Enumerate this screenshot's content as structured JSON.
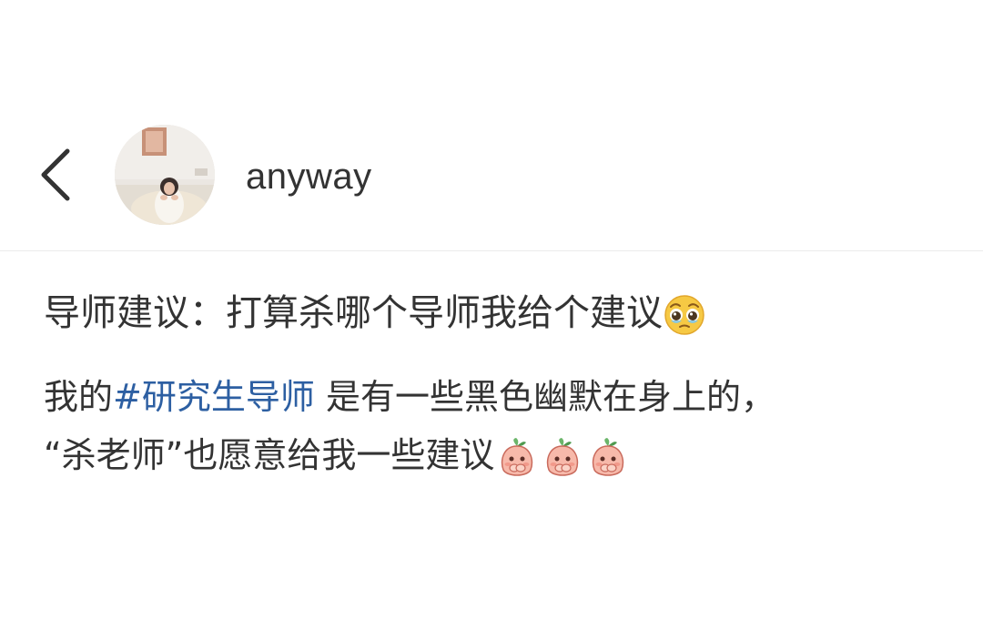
{
  "header": {
    "back_icon": "chevron-left-icon",
    "username": "anyway"
  },
  "post": {
    "title": "导师建议：打算杀哪个导师我给个建议",
    "title_emoji": "pleading-face-icon",
    "body_prefix": "我的",
    "hashtag": "#研究生导师",
    "body_rest": " 是有一些黑色幽默在身上的，",
    "body_line2": "“杀老师”也愿意给我一些建议",
    "trailing_emoji": "peach-face-icon",
    "trailing_emoji_count": 3
  },
  "colors": {
    "text": "#333333",
    "hashtag": "#2d5fa2",
    "divider": "#ececec"
  }
}
